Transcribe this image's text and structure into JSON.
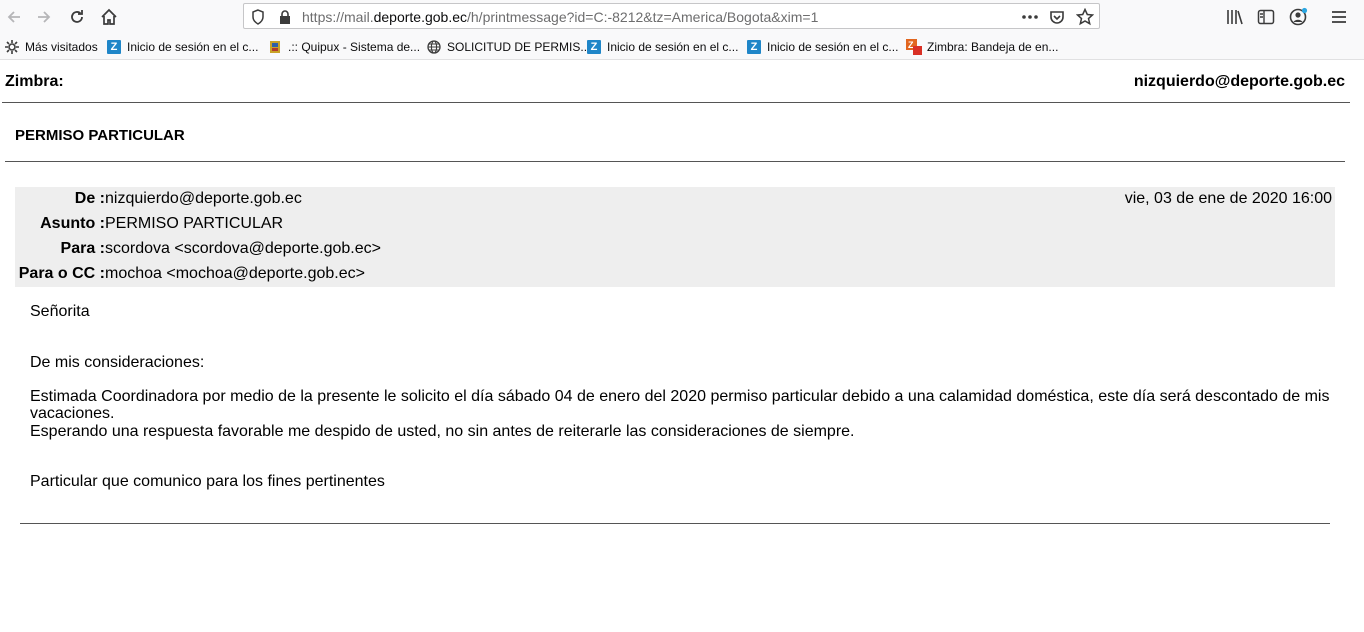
{
  "browser": {
    "url_prefix": "https://mail.",
    "url_domain": "deporte.gob.ec",
    "url_path": "/h/printmessage?id=C:-8212&tz=America/Bogota&xim=1",
    "icons": [
      "back-icon",
      "forward-icon",
      "reload-icon",
      "home-icon",
      "shield-icon",
      "lock-icon",
      "more-icon",
      "pocket-icon",
      "star-icon",
      "library-icon",
      "sidebar-icon",
      "account-icon",
      "menu-icon"
    ]
  },
  "bookmarks": [
    {
      "label": "Más visitados",
      "icon": "gear-icon"
    },
    {
      "label": "Inicio de sesión en el c...",
      "icon": "zimbra-icon"
    },
    {
      "label": ".:: Quipux - Sistema de...",
      "icon": "quipux-icon"
    },
    {
      "label": "SOLICITUD DE PERMIS...",
      "icon": "globe-icon"
    },
    {
      "label": "Inicio de sesión en el c...",
      "icon": "zimbra-icon"
    },
    {
      "label": "Inicio de sesión en el c...",
      "icon": "zimbra-icon"
    },
    {
      "label": "Zimbra: Bandeja de en...",
      "icon": "zimbra-mail-icon"
    }
  ],
  "page": {
    "app": "Zimbra:",
    "user": "nizquierdo@deporte.gob.ec",
    "subject_title": "PERMISO PARTICULAR"
  },
  "message": {
    "from_label": "De :",
    "from": "nizquierdo@deporte.gob.ec",
    "date": "vie, 03 de ene de 2020 16:00",
    "subject_label": "Asunto :",
    "subject": "PERMISO PARTICULAR",
    "to_label": "Para :",
    "to": "scordova <scordova@deporte.gob.ec>",
    "cc_label": "Para o CC :",
    "cc": "mochoa <mochoa@deporte.gob.ec>",
    "body": {
      "greeting": "Señorita",
      "line1": "De mis consideraciones:",
      "line2": "Estimada Coordinadora por medio de la presente le solicito el día sábado 04 de enero del 2020 permiso particular debido a una calamidad doméstica, este día será descontado de mis vacaciones.",
      "line3": "Esperando una respuesta favorable me despido de usted, no sin antes de reiterarle las consideraciones de siempre.",
      "closing": "Particular que comunico para los fines pertinentes"
    }
  }
}
